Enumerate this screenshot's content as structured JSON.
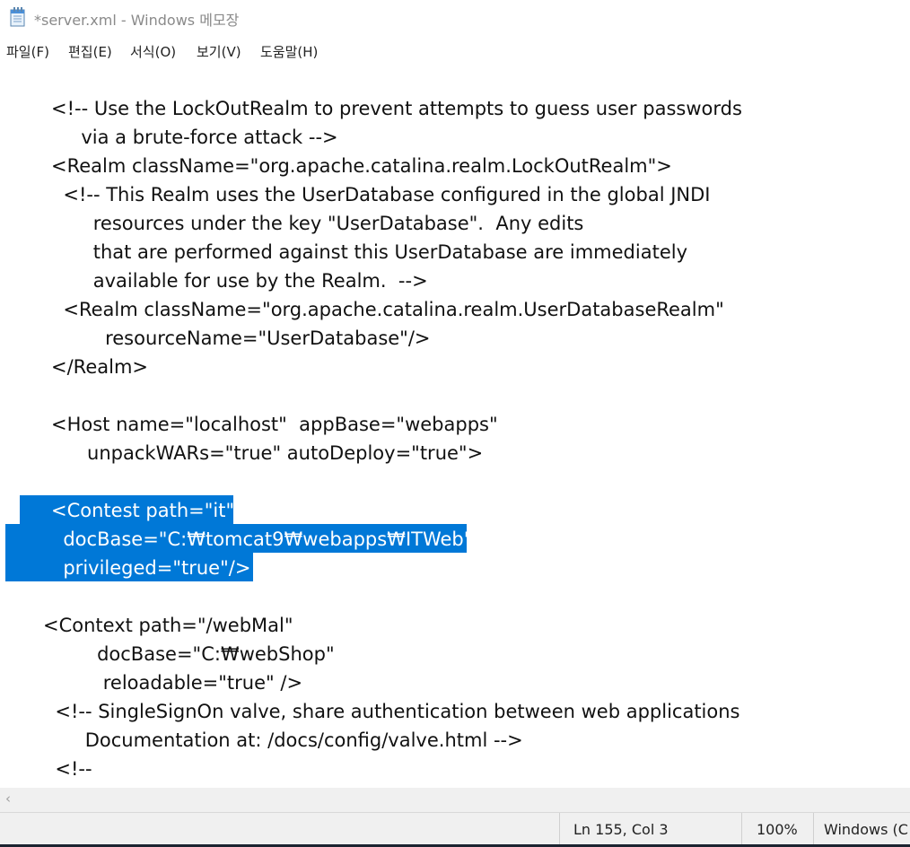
{
  "window": {
    "title": "*server.xml - Windows 메모장",
    "icon": "notepad-icon"
  },
  "menu": [
    "파일(F)",
    "편집(E)",
    "서식(O)",
    "보기(V)",
    "도움말(H)"
  ],
  "editor": {
    "lines": [
      "<!-- Use the LockOutRealm to prevent attempts to guess user passwords",
      "     via a brute-force attack -->",
      "<Realm className=\"org.apache.catalina.realm.LockOutRealm\">",
      "  <!-- This Realm uses the UserDatabase configured in the global JNDI",
      "       resources under the key \"UserDatabase\".  Any edits",
      "       that are performed against this UserDatabase are immediately",
      "       available for use by the Realm.  -->",
      "  <Realm className=\"org.apache.catalina.realm.UserDatabaseRealm\"",
      "         resourceName=\"UserDatabase\"/>",
      "</Realm>",
      "",
      "<Host name=\"localhost\"  appBase=\"webapps\"",
      "      unpackWARs=\"true\" autoDeploy=\"true\">",
      "",
      "<Contest path=\"it\"",
      "  docBase=\"C:₩tomcat9₩webapps₩ITWeb\"",
      "  privileged=\"true\"/>",
      "",
      "<Context path=\"/webMal\"",
      "         docBase=\"C:₩webShop\"",
      "          reloadable=\"true\" />",
      "  <!-- SingleSignOn valve, share authentication between web applications",
      "       Documentation at: /docs/config/valve.html -->",
      "  <!--"
    ],
    "selection_color": "#0078d7"
  },
  "scrollbar": {
    "left_arrow": "‹"
  },
  "status": {
    "position": "Ln 155, Col 3",
    "zoom": "100%",
    "encoding": "Windows (C"
  }
}
